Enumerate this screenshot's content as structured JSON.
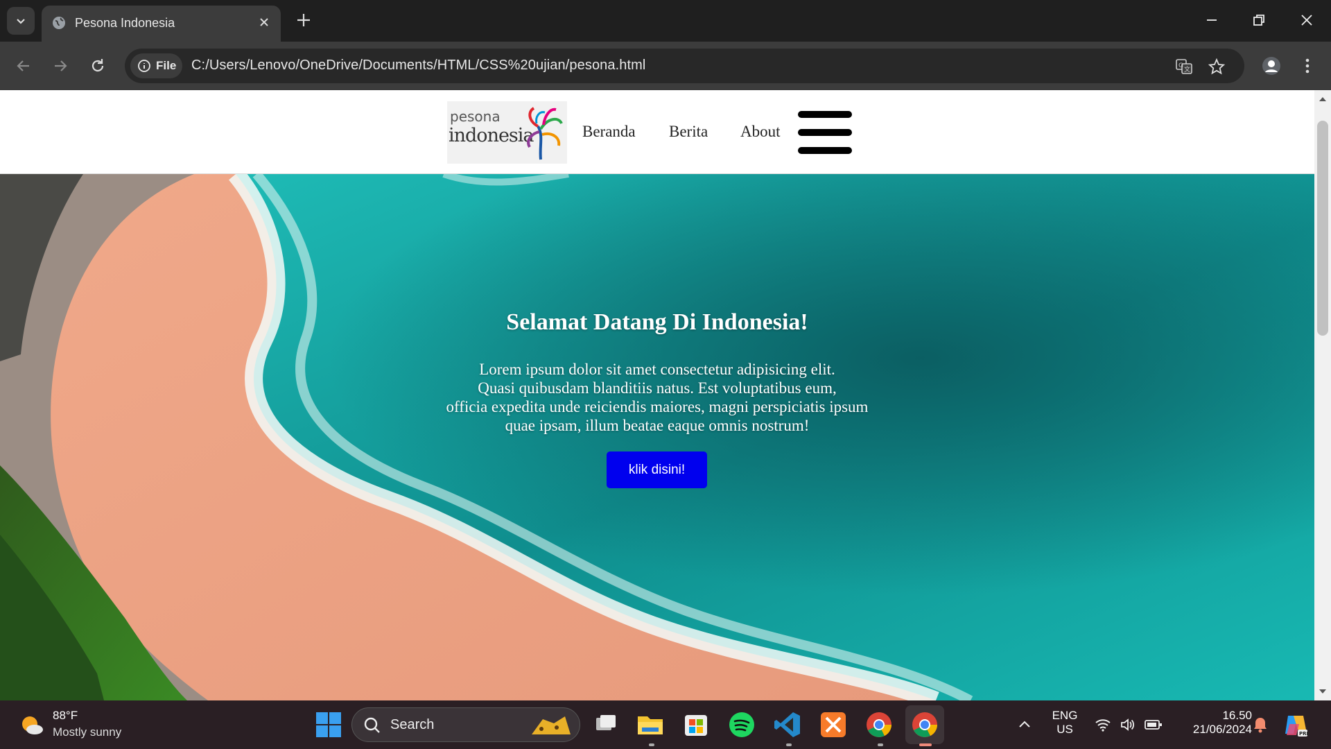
{
  "browser": {
    "tab_title": "Pesona Indonesia",
    "url": "C:/Users/Lenovo/OneDrive/Documents/HTML/CSS%20ujian/pesona.html",
    "file_chip": "File"
  },
  "site": {
    "logo": {
      "top": "pesona",
      "bottom": "indonesia"
    },
    "nav": [
      "Beranda",
      "Berita",
      "About"
    ],
    "hero": {
      "title": "Selamat Datang Di Indonesia!",
      "lines": [
        "Lorem ipsum dolor sit amet consectetur adipisicing elit.",
        "Quasi quibusdam blanditiis natus. Est voluptatibus eum,",
        "officia expedita unde reiciendis maiores, magni perspiciatis ipsum",
        "quae ipsam, illum beatae eaque omnis nostrum!"
      ],
      "button": "klik disini!"
    }
  },
  "taskbar": {
    "weather": {
      "temp": "88°F",
      "desc": "Mostly sunny"
    },
    "search_placeholder": "Search",
    "lang": {
      "line1": "ENG",
      "line2": "US"
    },
    "time": "16.50",
    "date": "21/06/2024",
    "apps": [
      "start-icon",
      "task-view-icon",
      "file-explorer-icon",
      "store-icon",
      "spotify-icon",
      "vscode-icon",
      "xampp-icon",
      "chrome-icon",
      "chrome-active-icon"
    ]
  },
  "colors": {
    "button": "#0000ee",
    "sea": "#17b8b0",
    "sand": "#eea688"
  }
}
